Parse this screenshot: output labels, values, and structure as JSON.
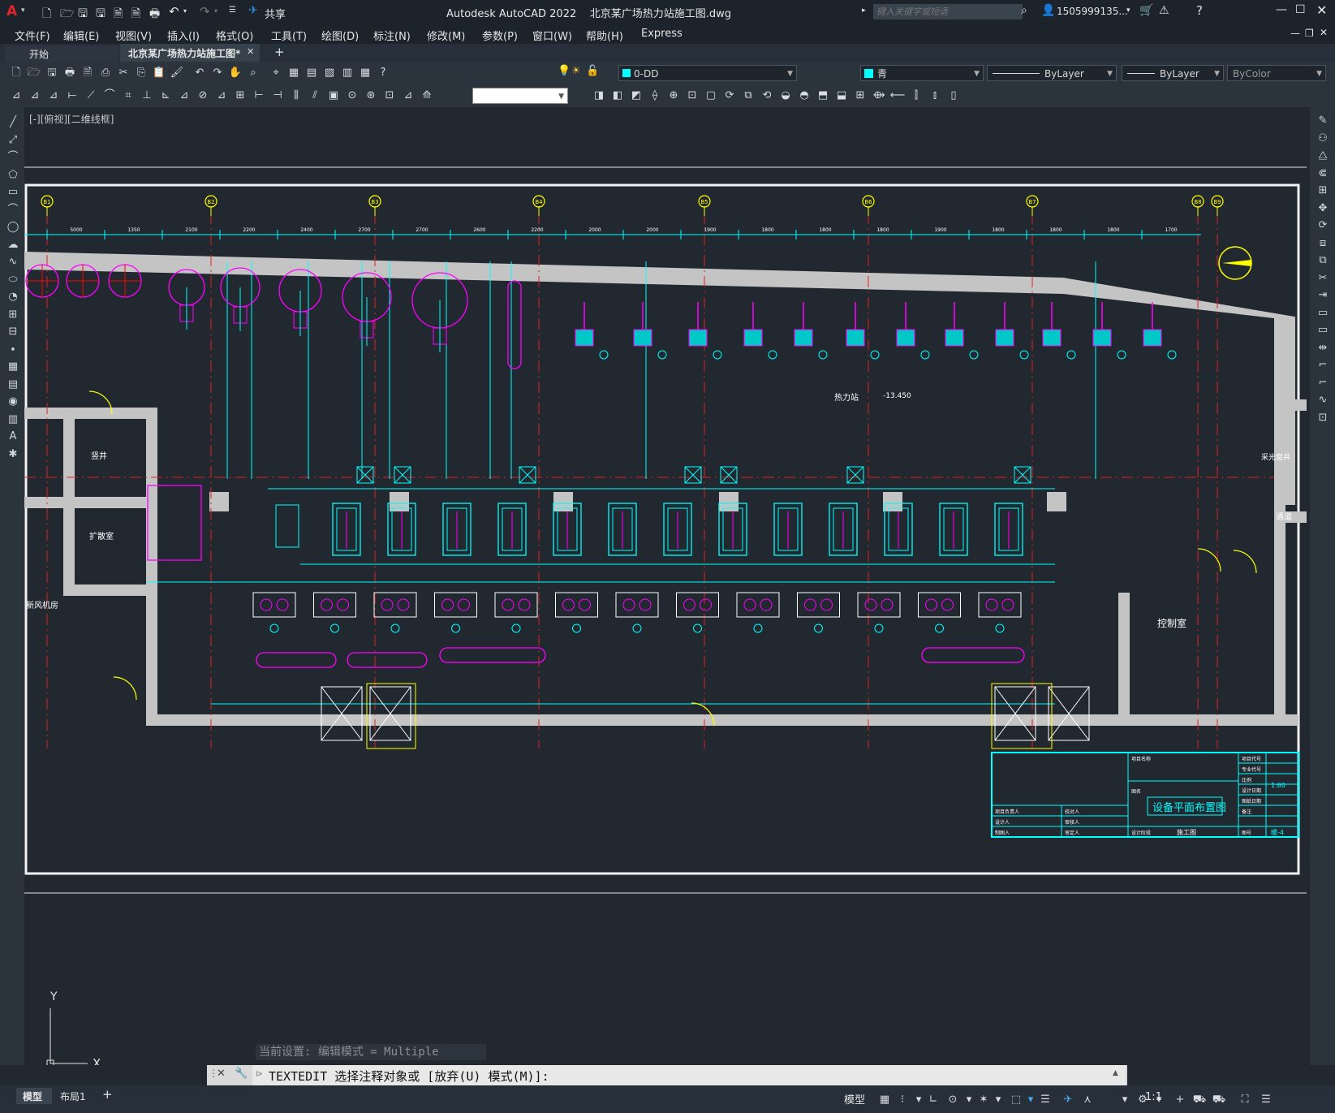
{
  "app": {
    "title": "Autodesk AutoCAD 2022    北京某广场热力站施工图.dwg",
    "logo_letter": "A",
    "share_label": "共享"
  },
  "search": {
    "placeholder": "键入关键字或短语",
    "user": "1505999135...",
    "user_caret": "▾"
  },
  "menu": {
    "items": [
      "文件(F)",
      "编辑(E)",
      "视图(V)",
      "插入(I)",
      "格式(O)",
      "工具(T)",
      "绘图(D)",
      "标注(N)",
      "修改(M)",
      "参数(P)",
      "窗口(W)",
      "帮助(H)",
      "Express"
    ]
  },
  "tabs": {
    "start": "开始",
    "file": "北京某广场热力站施工图*",
    "close": "✕",
    "add": "+"
  },
  "toolbar": {
    "layer": "0-DD",
    "color": "青",
    "linetype": "ByLayer",
    "lineweight": "ByLayer",
    "plotstyle": "ByColor"
  },
  "viewport_label": "[-][俯视][二维线框]",
  "drawing": {
    "grid_labels": [
      "B1",
      "B2",
      "B3",
      "B4",
      "B5",
      "B6",
      "B7",
      "B8",
      "B9"
    ],
    "top_dims": [
      "5000",
      "1350",
      "2100",
      "2200",
      "2400",
      "2700",
      "2700",
      "2600",
      "2200",
      "2000",
      "2000",
      "1900",
      "1800",
      "1800",
      "1800",
      "1900",
      "1800",
      "1800",
      "1800",
      "1700"
    ],
    "rooms": {
      "heat_station": "热力站",
      "elevation": "-13.450",
      "shaft": "竖井",
      "diffuser": "扩散室",
      "fresh_air": "新风机房",
      "control": "控制室",
      "passage": "通道",
      "light_well": "采光窗井"
    },
    "title_block": {
      "drawing_name": "设备平面布置图",
      "scale": "1:60",
      "sheet_no": "暖-4",
      "stage": "施工图",
      "labels": [
        "项目负责人",
        "设计人",
        "制图人",
        "校对人",
        "审核人",
        "审定人",
        "项目名称",
        "图名",
        "设计阶段",
        "项目代号",
        "专业代号",
        "比例",
        "设计日期",
        "图纸日期",
        "备注",
        "图号"
      ]
    }
  },
  "command": {
    "history": "当前设置: 编辑模式 = Multiple",
    "prompt": "TEXTEDIT 选择注释对象或 [放弃(U) 模式(M)]:",
    "close": "✕"
  },
  "ucs": {
    "y": "Y",
    "x": "X"
  },
  "status": {
    "model_tab": "模型",
    "layout_tab": "布局1",
    "add": "+",
    "model_btn": "模型",
    "scale": "1:1"
  }
}
